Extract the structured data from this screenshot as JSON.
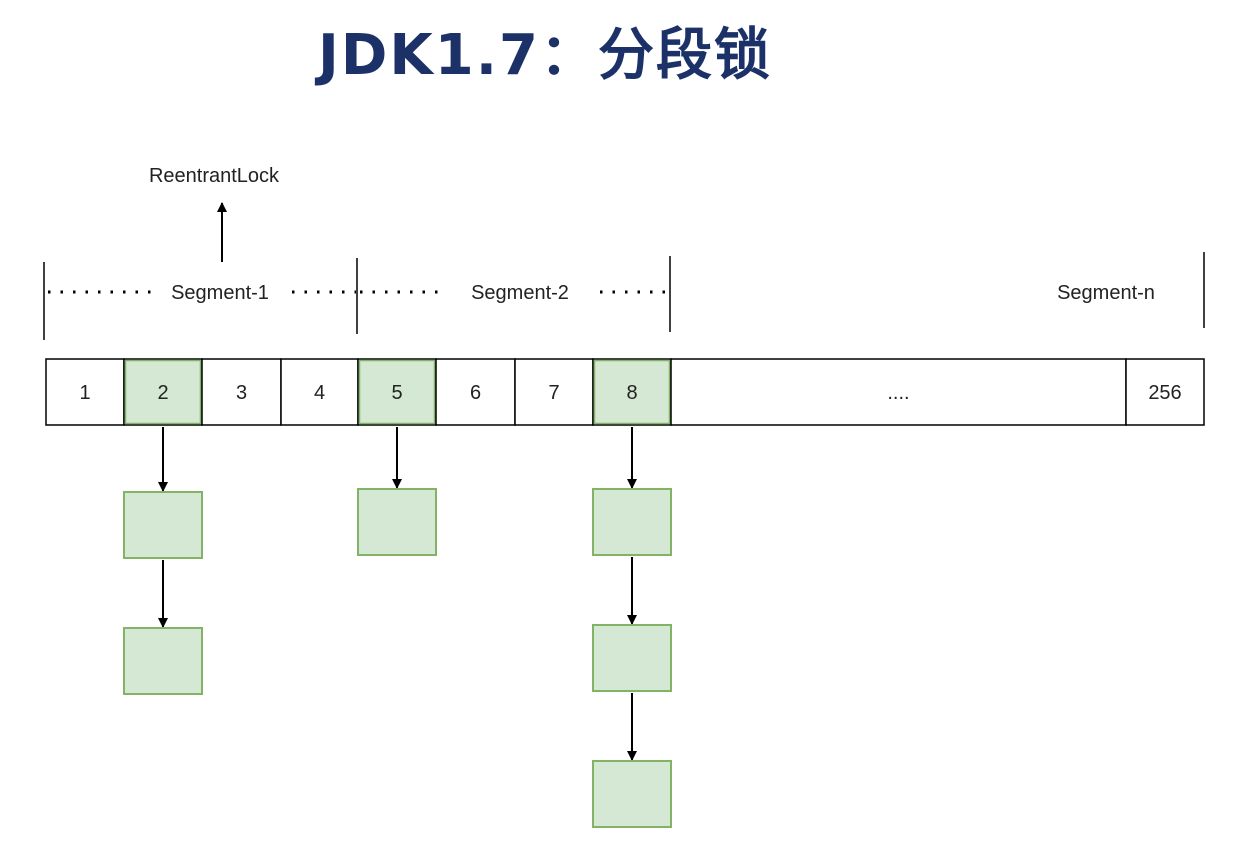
{
  "title": "JDK1.7：分段锁",
  "lock_label": "ReentrantLock",
  "segments": [
    {
      "label": "Segment-1"
    },
    {
      "label": "Segment-2"
    },
    {
      "label": "Segment-n"
    }
  ],
  "cells": [
    {
      "label": "1",
      "highlighted": false
    },
    {
      "label": "2",
      "highlighted": true
    },
    {
      "label": "3",
      "highlighted": false
    },
    {
      "label": "4",
      "highlighted": false
    },
    {
      "label": "5",
      "highlighted": true
    },
    {
      "label": "6",
      "highlighted": false
    },
    {
      "label": "7",
      "highlighted": false
    },
    {
      "label": "8",
      "highlighted": true
    },
    {
      "label": "....",
      "highlighted": false
    },
    {
      "label": "256",
      "highlighted": false
    }
  ],
  "chains": [
    {
      "bucket": "2",
      "nodes": 2
    },
    {
      "bucket": "5",
      "nodes": 1
    },
    {
      "bucket": "8",
      "nodes": 3
    }
  ],
  "colors": {
    "title": "#1b3168",
    "highlight_fill": "#d5e8d4",
    "highlight_stroke": "#82b366",
    "line": "#000000"
  }
}
